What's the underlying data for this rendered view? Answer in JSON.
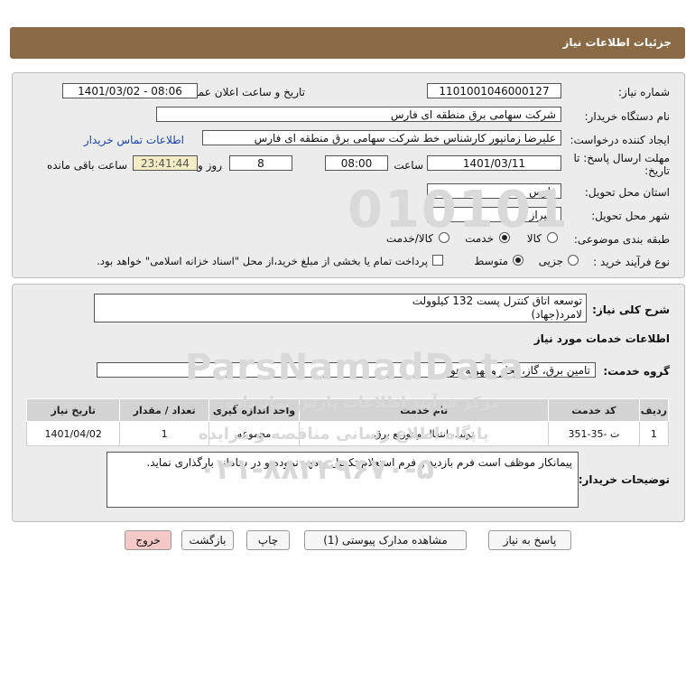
{
  "header": {
    "title": "جزئیات اطلاعات نیاز"
  },
  "form": {
    "need_number_label": "شماره نیاز:",
    "need_number": "1101001046000127",
    "announce_label": "تاریخ و ساعت اعلان عمومی:",
    "announce_value": "1401/03/02 - 08:06",
    "buyer_label": "نام دستگاه خریدار:",
    "buyer_value": "شرکت سهامی برق منطقه ای فارس",
    "creator_label": "ایجاد کننده درخواست:",
    "creator_value": "علیرضا زمانپور کارشناس خط شرکت سهامی برق منطقه ای فارس",
    "contact_link": "اطلاعات تماس خریدار",
    "deadline_label_1": "مهلت ارسال پاسخ: تا",
    "deadline_label_2": "تاریخ:",
    "deadline_date": "1401/03/11",
    "time_label": "ساعت",
    "deadline_time": "08:00",
    "days_value": "8",
    "days_label": "روز و",
    "remaining_time": "23:41:44",
    "remaining_label": "ساعت باقی مانده",
    "province_label": "استان محل تحویل:",
    "province_value": "فارس",
    "city_label": "شهر محل تحویل:",
    "city_value": "شیراز",
    "category_label": "طبقه بندی موضوعی:",
    "category_options": [
      "کالا",
      "خدمت",
      "کالا/خدمت"
    ],
    "category_selected": "خدمت",
    "process_label": "نوع فرآیند خرید :",
    "process_options": [
      "جزیی",
      "متوسط"
    ],
    "process_selected": "متوسط",
    "payment_note": "پرداخت تمام یا بخشی از مبلغ خرید،از محل \"اسناد خزانه اسلامی\" خواهد بود."
  },
  "details": {
    "summary_label": "شرح کلی نیاز:",
    "summary_line1": "توسعه اتاق کنترل پست 132 کیلوولت",
    "summary_line2": "لامرد(جهاد)",
    "services_heading": "اطلاعات خدمات مورد نیاز",
    "service_group_label": "گروه خدمت:",
    "service_group_value": "تامین برق، گاز، بخار و تهویه هوا",
    "table": {
      "headers": [
        "ردیف",
        "کد خدمت",
        "نام خدمت",
        "واحد اندازه گیری",
        "تعداد / مقدار",
        "تاریخ نیاز"
      ],
      "rows": [
        [
          "1",
          "ت -35-351",
          "تولید، انتقال و توزیع برق",
          "مجموعه",
          "1",
          "1401/04/02"
        ]
      ]
    },
    "buyer_notes_label": "توضیحات خریدار:",
    "buyer_notes": "پیمانکار موظف است فرم بازدید و فرم استعلام تکمیل و مهر نموده و در سامانه بارگذاری نماید."
  },
  "buttons": {
    "reply": "پاسخ به نیاز",
    "docs": "مشاهده مدارک پیوستی (1)",
    "print": "چاپ",
    "back": "بازگشت",
    "exit": "خروج"
  },
  "watermark": {
    "brand": "ParsNamadData",
    "line1": "مرکز فرآیند اطلاعات پارس نماد داده",
    "line2": "پایگاه اطلاع رسانی مناقصه و مزایده",
    "phone": "۰۲۱-۸۸۳۴۹۶۷۰-۵"
  },
  "colors": {
    "header_bg": "#8b6b45",
    "panel_bg": "#ececec",
    "link": "#1a46a8",
    "remaining_bg": "#f3ecc4",
    "exit_bg": "#f6c9c9"
  }
}
